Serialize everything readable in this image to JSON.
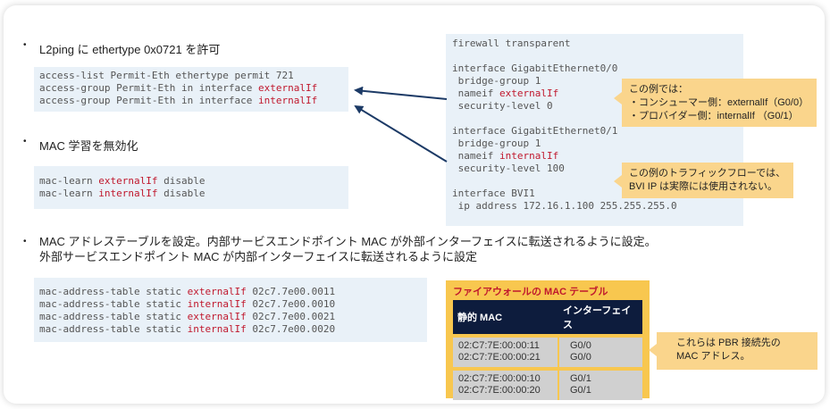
{
  "bullets": {
    "b1": "L2ping に ethertype 0x0721 を許可",
    "b2": "MAC 学習を無効化",
    "b3_line1": "MAC アドレステーブルを設定。内部サービスエンドポイント MAC が外部インターフェイスに転送されるように設定。",
    "b3_line2": "外部サービスエンドポイント MAC が内部インターフェイスに転送されるように設定",
    "dot": "•"
  },
  "acl": {
    "l1": "access-list Permit-Eth ethertype permit 721",
    "l2_pre": "access-group Permit-Eth in interface ",
    "l2_hl": "externalIf",
    "l3_pre": "access-group Permit-Eth in interface ",
    "l3_hl": "internalIf"
  },
  "maclearn": {
    "l1_pre": "mac-learn ",
    "l1_hl": "externalIf",
    "l1_post": " disable",
    "l2_pre": "mac-learn ",
    "l2_hl": "internalIf",
    "l2_post": " disable"
  },
  "mactable_cfg": {
    "prefix": "mac-address-table static ",
    "rows": [
      {
        "iface": "externalIf",
        "mac": " 02c7.7e00.0011"
      },
      {
        "iface": "internalIf",
        "mac": " 02c7.7e00.0010"
      },
      {
        "iface": "externalIf",
        "mac": " 02c7.7e00.0021"
      },
      {
        "iface": "internalIf",
        "mac": " 02c7.7e00.0020"
      }
    ]
  },
  "fw_config": {
    "l1": "firewall transparent",
    "l2": "interface GigabitEthernet0/0",
    "l3": " bridge-group 1",
    "l4_pre": " nameif ",
    "l4_hl": "externalIf",
    "l5": " security-level 0",
    "l6": "interface GigabitEthernet0/1",
    "l7": " bridge-group 1",
    "l8_pre": " nameif ",
    "l8_hl": "internalIf",
    "l9": " security-level 100",
    "l10": "interface BVI1",
    "l11": " ip address 172.16.1.100 255.255.255.0"
  },
  "callouts": {
    "c1_l1": "この例では：",
    "c1_l2": "・コンシューマー側：externalIf（G0/0）",
    "c1_l3": "・プロバイダー側：internalIf （G0/1）",
    "c2_l1": "この例のトラフィックフローでは、",
    "c2_l2": "BVI IP は実際には使用されない。",
    "c3_l1": "これらは PBR 接続先の",
    "c3_l2": "MAC アドレス。"
  },
  "mac_table": {
    "title": "ファイアウォールの MAC テーブル",
    "headers": [
      "静的 MAC",
      "インターフェイス"
    ],
    "group1": {
      "mac1": "02:C7:7E:00:00:11",
      "mac2": "02:C7:7E:00:00:21",
      "if1": "G0/0",
      "if2": "G0/0"
    },
    "group2": {
      "mac1": "02:C7:7E:00:00:10",
      "mac2": "02:C7:7E:00:00:20",
      "if1": "G0/1",
      "if2": "G0/1"
    }
  },
  "colors": {
    "highlight": "#c0182d",
    "code_bg": "#e9f1f8",
    "callout": "#fad58c",
    "panel": "#f8c74f",
    "arrow": "#1c3a66"
  }
}
